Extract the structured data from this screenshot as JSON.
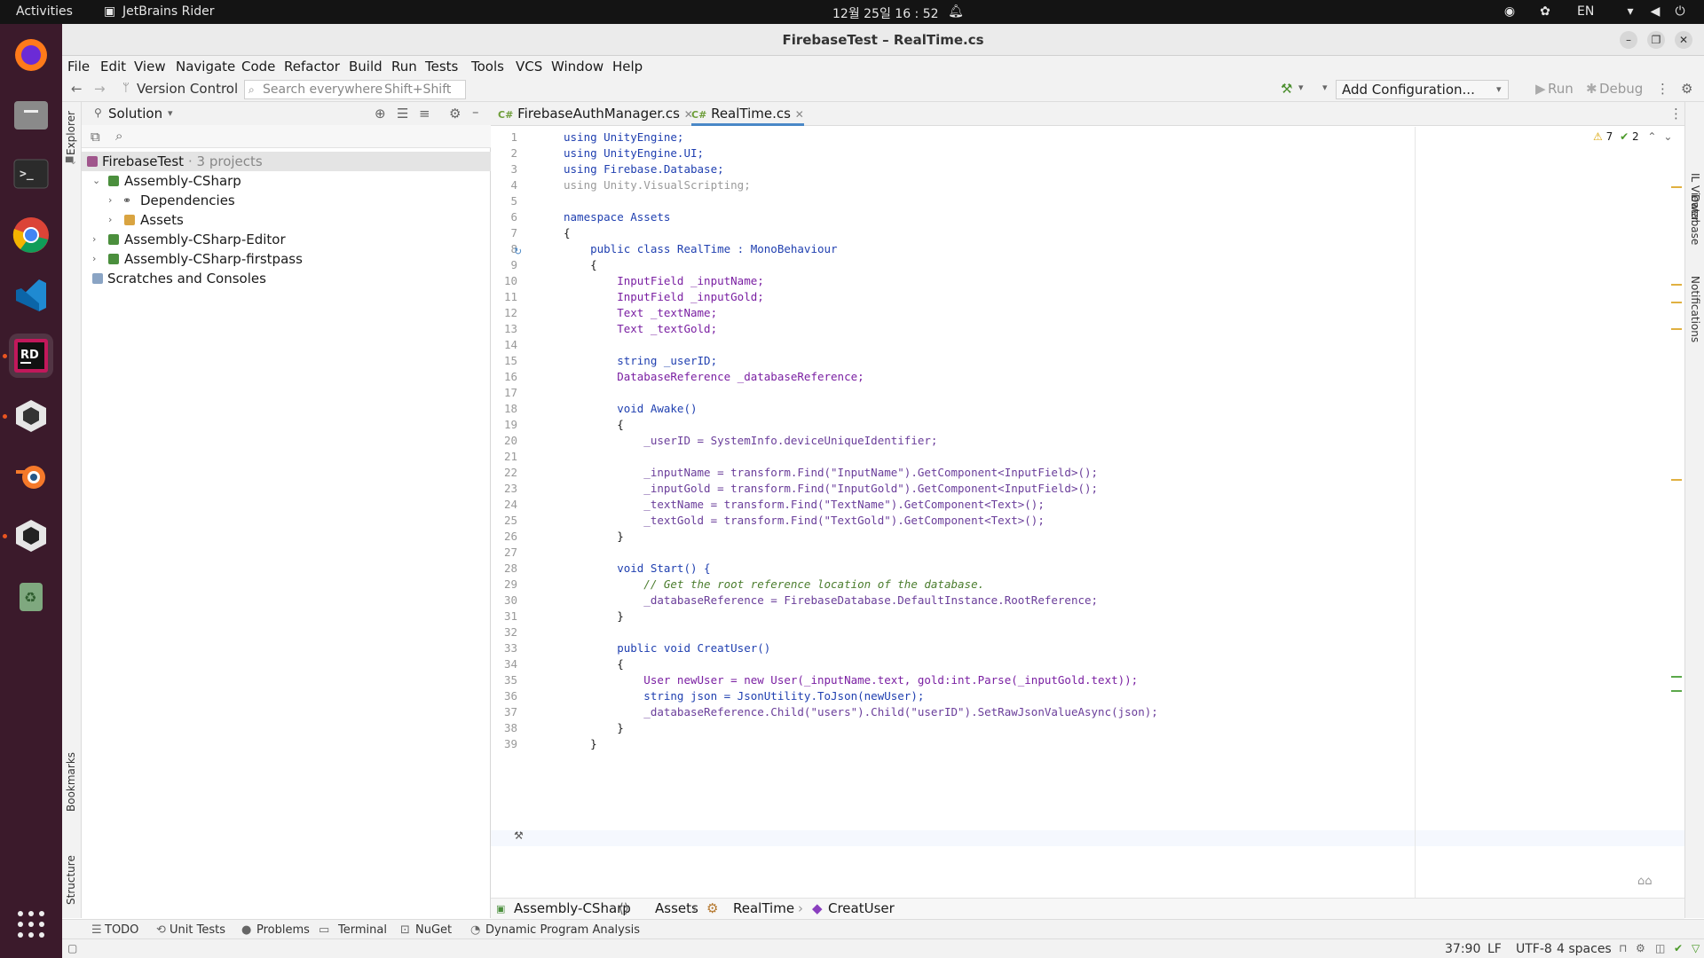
{
  "topbar": {
    "activities": "Activities",
    "app_name": "JetBrains Rider",
    "clock": "12월 25일  16 : 52",
    "lang": "EN"
  },
  "window": {
    "title": "FirebaseTest – RealTime.cs"
  },
  "menu": [
    "File",
    "Edit",
    "View",
    "Navigate",
    "Code",
    "Refactor",
    "Build",
    "Run",
    "Tests",
    "Tools",
    "VCS",
    "Window",
    "Help"
  ],
  "toolbar": {
    "version_control": "Version Control",
    "search_placeholder": "Search everywhere",
    "search_shortcut": "Shift+Shift",
    "config": "Add Configuration...",
    "run": "Run",
    "debug": "Debug"
  },
  "left_stripe": {
    "explorer": "Explorer",
    "bookmarks": "Bookmarks",
    "structure": "Structure"
  },
  "explorer": {
    "title": "Solution",
    "tree": [
      {
        "label": "FirebaseTest",
        "suffix": " · 3 projects"
      },
      {
        "label": "Assembly-CSharp"
      },
      {
        "label": "Dependencies"
      },
      {
        "label": "Assets"
      },
      {
        "label": "Assembly-CSharp-Editor"
      },
      {
        "label": "Assembly-CSharp-firstpass"
      },
      {
        "label": "Scratches and Consoles"
      }
    ]
  },
  "tabs": [
    {
      "label": "FirebaseAuthManager.cs"
    },
    {
      "label": "RealTime.cs"
    }
  ],
  "inspections": {
    "warnings": "7",
    "ok": "2"
  },
  "code": {
    "line_numbers": [
      "1",
      "2",
      "3",
      "4",
      "5",
      "6",
      "7",
      "8",
      "9",
      "10",
      "11",
      "12",
      "13",
      "14",
      "15",
      "16",
      "17",
      "18",
      "19",
      "20",
      "21",
      "22",
      "23",
      "24",
      "25",
      "26",
      "27",
      "28",
      "29",
      "30",
      "31",
      "32",
      "33",
      "34",
      "35",
      "36",
      "37",
      "38",
      "39"
    ],
    "lines": [
      "using UnityEngine;",
      "using UnityEngine.UI;",
      "using Firebase.Database;",
      "using Unity.VisualScripting;",
      "",
      "namespace Assets",
      "{",
      "    public class RealTime : MonoBehaviour",
      "    {",
      "        InputField _inputName;",
      "        InputField _inputGold;",
      "        Text _textName;",
      "        Text _textGold;",
      "",
      "        string _userID;",
      "        DatabaseReference _databaseReference;",
      "",
      "        void Awake()",
      "        {",
      "            _userID = SystemInfo.deviceUniqueIdentifier;",
      "",
      "            _inputName = transform.Find(\"InputName\").GetComponent<InputField>();",
      "            _inputGold = transform.Find(\"InputGold\").GetComponent<InputField>();",
      "            _textName = transform.Find(\"TextName\").GetComponent<Text>();",
      "            _textGold = transform.Find(\"TextGold\").GetComponent<Text>();",
      "        }",
      "",
      "        void Start() {",
      "            // Get the root reference location of the database.",
      "            _databaseReference = FirebaseDatabase.DefaultInstance.RootReference;",
      "        }",
      "",
      "        public void CreatUser()",
      "        {",
      "            User newUser = new User(_inputName.text, gold:int.Parse(_inputGold.text));",
      "            string json = JsonUtility.ToJson(newUser);",
      "            _databaseReference.Child(\"users\").Child(\"userID\").SetRawJsonValueAsync(json);",
      "        }",
      "    }"
    ],
    "inlay_hint": "gold:"
  },
  "breadcrumb": [
    "Assembly-CSharp",
    "Assets",
    "RealTime",
    "CreatUser"
  ],
  "right_stripe": {
    "il_viewer": "IL Viewer",
    "database": "Database",
    "notifications": "Notifications"
  },
  "bottom_tabs": [
    "TODO",
    "Unit Tests",
    "Problems",
    "Terminal",
    "NuGet",
    "Dynamic Program Analysis"
  ],
  "status": {
    "position": "37:90",
    "line_sep": "LF",
    "encoding": "UTF-8",
    "indent": "4 spaces"
  },
  "colors": {
    "accent": "#4a88c7",
    "dock_bg": "#3b1a2b",
    "warning": "#e0b040"
  }
}
